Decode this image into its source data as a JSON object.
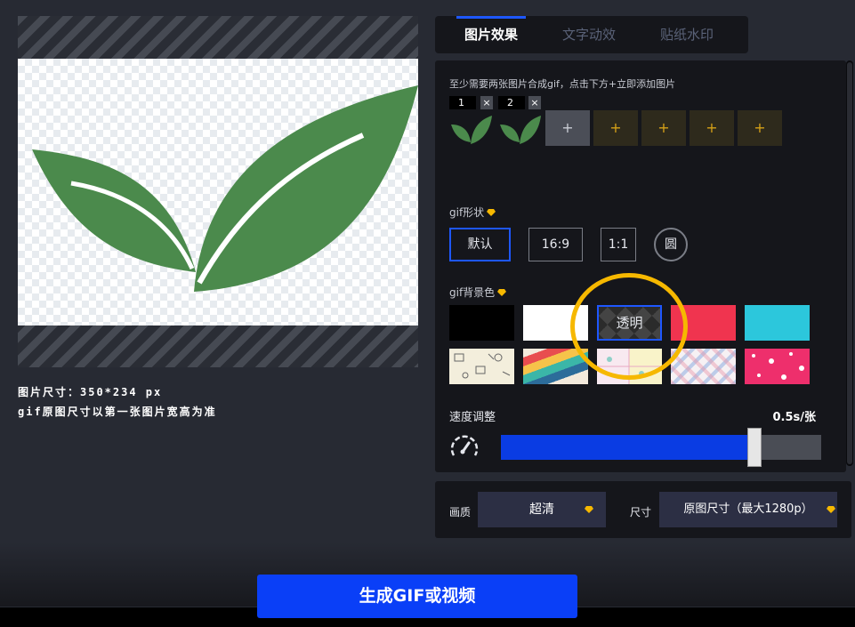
{
  "tabs": [
    {
      "label": "图片效果",
      "active": true
    },
    {
      "label": "文字动效",
      "active": false
    },
    {
      "label": "贴纸水印",
      "active": false
    }
  ],
  "preview": {
    "size_text": "图片尺寸：350*234 px",
    "note_text": "gif原图尺寸以第一张图片宽高为准"
  },
  "images": {
    "hint": "至少需要两张图片合成gif，点击下方+立即添加图片",
    "slots": [
      {
        "num": "1",
        "remove": "×"
      },
      {
        "num": "2",
        "remove": "×"
      }
    ],
    "add_label": "+"
  },
  "shape": {
    "label": "gif形状",
    "options": [
      "默认",
      "16:9",
      "1:1",
      "圆"
    ],
    "selected": "默认"
  },
  "background": {
    "label": "gif背景色",
    "selected_label": "透明",
    "colors": [
      "#000000",
      "#ffffff",
      "transparent",
      "#f0344f",
      "#2cc7dc"
    ]
  },
  "speed": {
    "label": "速度调整",
    "value": "0.5s/张",
    "fill_fraction": 0.77
  },
  "quality": {
    "label": "画质",
    "value": "超清"
  },
  "size": {
    "label": "尺寸",
    "value": "原图尺寸（最大1280p）"
  },
  "generate_label": "生成GIF或视频",
  "colors": {
    "accent": "#1e57ff",
    "button": "#0a3ff7",
    "leaf": "#4b8a4c",
    "highlight_ring": "#f6b800"
  }
}
